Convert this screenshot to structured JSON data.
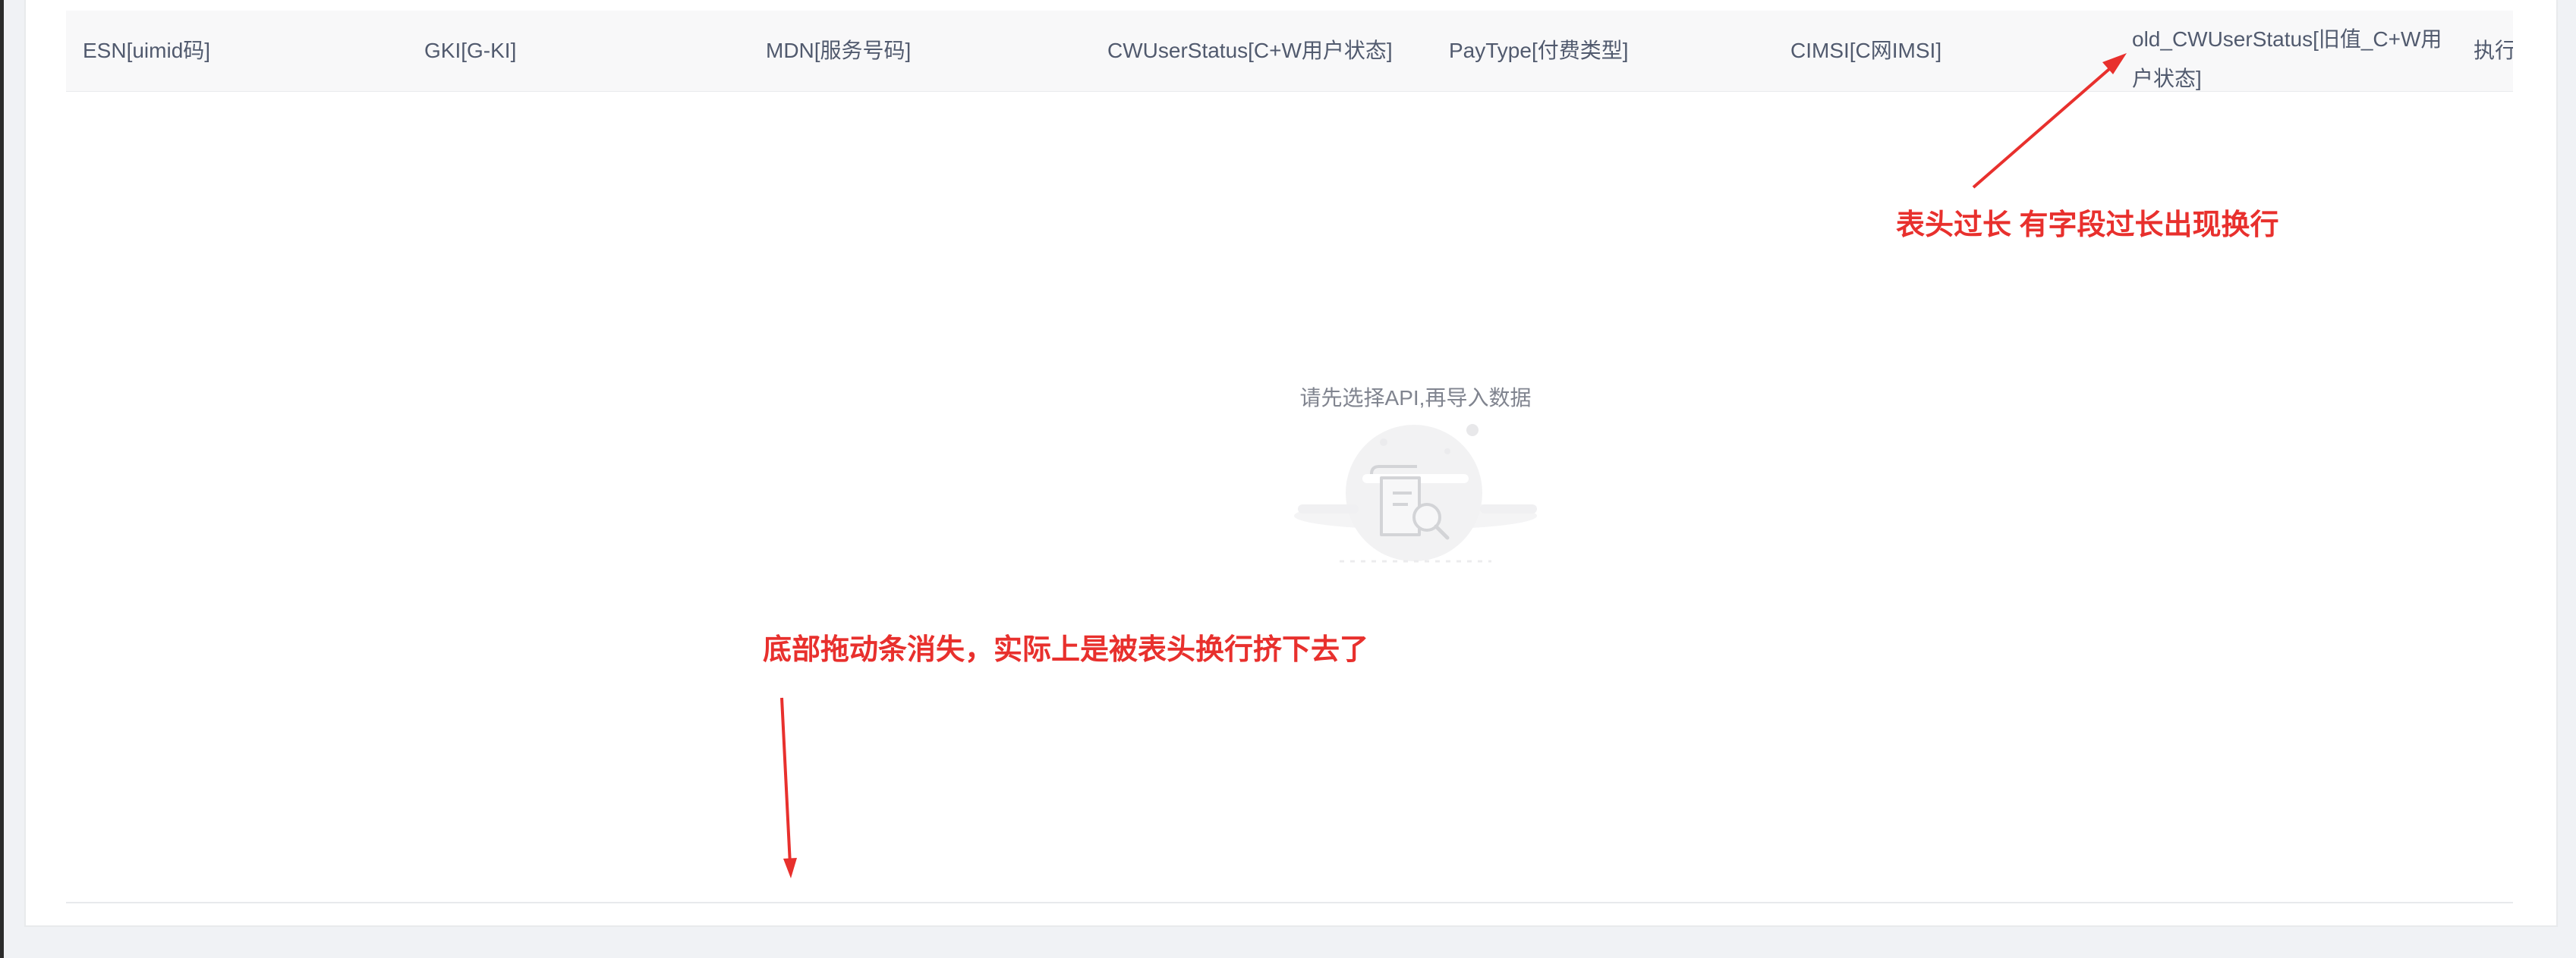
{
  "table": {
    "columns": [
      {
        "label": "ESN[uimid码]"
      },
      {
        "label": "GKI[G-KI]"
      },
      {
        "label": "MDN[服务号码]"
      },
      {
        "label": "CWUserStatus[C+W用户状态]"
      },
      {
        "label": "PayType[付费类型]"
      },
      {
        "label": "CIMSI[C网IMSI]"
      },
      {
        "label": "old_CWUserStatus[旧值_C+W用户状态]"
      },
      {
        "label": "执行"
      }
    ],
    "empty_text": "请先选择API,再导入数据"
  },
  "annotations": {
    "header_wrap": "表头过长  有字段过长出现换行",
    "scrollbar_missing": "底部拖动条消失，实际上是被表头换行挤下去了"
  },
  "colors": {
    "annotation": "#e8302d",
    "header_bg": "#f8f8f9"
  },
  "icons": {
    "empty": "empty-document-search-illustration"
  }
}
